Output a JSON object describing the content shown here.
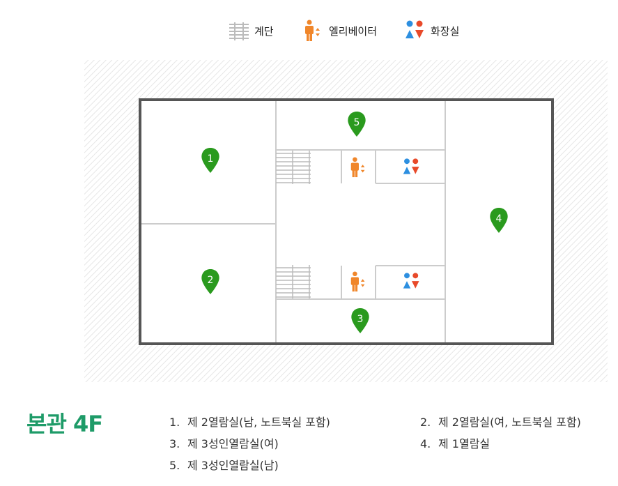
{
  "legend": {
    "stairs": "계단",
    "elevator": "엘리베이터",
    "restroom": "화장실"
  },
  "markers": [
    "1",
    "2",
    "3",
    "4",
    "5"
  ],
  "floor_title": "본관 4F",
  "rooms": [
    {
      "num": "1.",
      "name": "제 2열람실(남, 노트북실 포함)"
    },
    {
      "num": "2.",
      "name": "제 2열람실(여, 노트북실 포함)"
    },
    {
      "num": "3.",
      "name": "제 3성인열람실(여)"
    },
    {
      "num": "4.",
      "name": "제 1열람실"
    },
    {
      "num": "5.",
      "name": "제 3성인열람실(남)"
    }
  ],
  "colors": {
    "marker": "#2a9a1e",
    "elevator": "#f0862a",
    "restroom_male": "#2d8fe0",
    "restroom_female": "#e84a2a",
    "title": "#1e9b68"
  }
}
